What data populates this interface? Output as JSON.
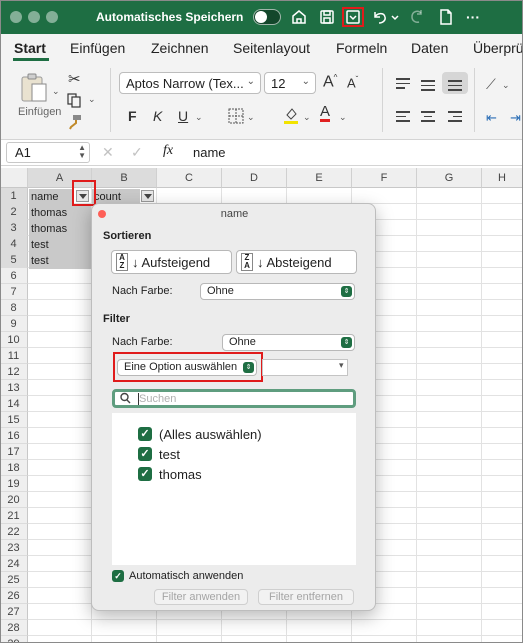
{
  "titlebar": {
    "autosave_label": "Automatisches Speichern",
    "icons": [
      "home-icon",
      "save-icon",
      "customize-toolbar-icon",
      "undo-icon",
      "redo-icon",
      "new-document-icon"
    ]
  },
  "ribbon": {
    "tabs": [
      {
        "label": "Start",
        "active": true
      },
      {
        "label": "Einfügen"
      },
      {
        "label": "Zeichnen"
      },
      {
        "label": "Seitenlayout"
      },
      {
        "label": "Formeln"
      },
      {
        "label": "Daten"
      },
      {
        "label": "Überprü"
      }
    ],
    "paste_label": "Einfügen",
    "font_name": "Aptos Narrow (Tex...",
    "font_size": "12",
    "grow_font": "A",
    "shrink_font": "A",
    "bold": "F",
    "italic": "K",
    "underline": "U",
    "font_color": "A"
  },
  "formula_bar": {
    "cell_ref": "A1",
    "fx": "fx",
    "value": "name"
  },
  "sheet": {
    "columns": [
      "A",
      "B",
      "C",
      "D",
      "E",
      "F",
      "G",
      "H"
    ],
    "rows": [
      "1",
      "2",
      "3",
      "4",
      "5",
      "6",
      "7",
      "8",
      "9",
      "10",
      "11",
      "12",
      "13",
      "14",
      "15",
      "16",
      "17",
      "18",
      "19",
      "20",
      "21",
      "22",
      "23",
      "24",
      "25",
      "26",
      "27",
      "28",
      "29"
    ],
    "header_a": "name",
    "header_b": "count",
    "values_a": [
      "thomas",
      "thomas",
      "test",
      "test"
    ]
  },
  "filter_popup": {
    "title": "name",
    "sort_heading": "Sortieren",
    "sort_asc": "Aufsteigend",
    "sort_desc": "Absteigend",
    "sort_by_color_label": "Nach Farbe:",
    "sort_by_color_value": "Ohne",
    "filter_heading": "Filter",
    "filter_by_color_label": "Nach Farbe:",
    "filter_by_color_value": "Ohne",
    "option_select": "Eine Option auswählen",
    "search_placeholder": "Suchen",
    "items": [
      {
        "label": "(Alles auswählen)",
        "checked": true
      },
      {
        "label": "test",
        "checked": true
      },
      {
        "label": "thomas",
        "checked": true
      }
    ],
    "auto_apply_label": "Automatisch anwenden",
    "auto_apply_checked": true,
    "apply_button": "Filter anwenden",
    "clear_button": "Filter entfernen"
  },
  "colors": {
    "accent": "#1e6e43",
    "highlight": "#e01b1b"
  }
}
